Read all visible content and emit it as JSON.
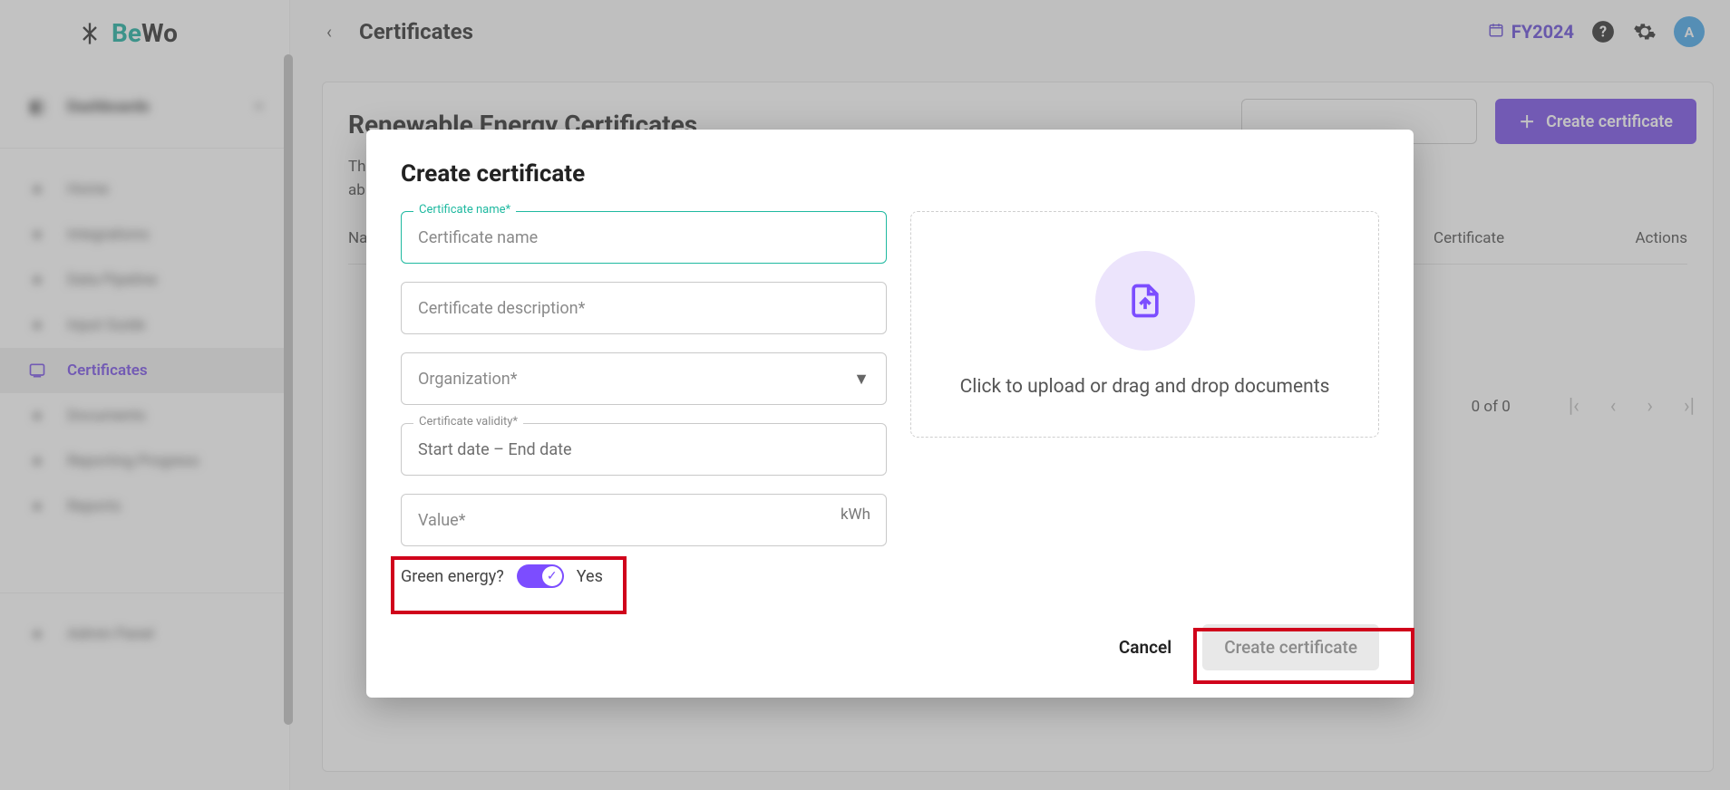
{
  "brand": {
    "name_a": "Be",
    "name_b": "Wo"
  },
  "sidebar": {
    "group_label": "Dashboards",
    "items": [
      {
        "label": "Home"
      },
      {
        "label": "Integrations"
      },
      {
        "label": "Data Pipeline"
      },
      {
        "label": "Input Guide"
      },
      {
        "label": "Certificates"
      },
      {
        "label": "Documents"
      },
      {
        "label": "Reporting Progress"
      },
      {
        "label": "Reports"
      }
    ],
    "footer_item": "Admin Panel"
  },
  "topbar": {
    "title": "Certificates",
    "fiscal_year": "FY2024",
    "avatar_initial": "A"
  },
  "main": {
    "heading": "Renewable Energy Certificates",
    "description_prefix": "Th",
    "description_line2_prefix": "ab",
    "columns": {
      "name": "Nar",
      "certificate": "Certificate",
      "actions": "Actions"
    },
    "create_button": "Create certificate",
    "pager": {
      "count": "0 of 0"
    }
  },
  "modal": {
    "title": "Create certificate",
    "fields": {
      "name_label": "Certificate name*",
      "name_placeholder": "Certificate name",
      "description_placeholder": "Certificate description*",
      "organization_placeholder": "Organization*",
      "validity_label": "Certificate validity*",
      "validity_placeholder": "Start date – End date",
      "value_placeholder": "Value*",
      "value_unit": "kWh"
    },
    "toggle": {
      "question": "Green energy?",
      "value_label": "Yes"
    },
    "dropzone_text": "Click to upload or drag and drop documents",
    "actions": {
      "cancel": "Cancel",
      "create": "Create certificate"
    }
  }
}
